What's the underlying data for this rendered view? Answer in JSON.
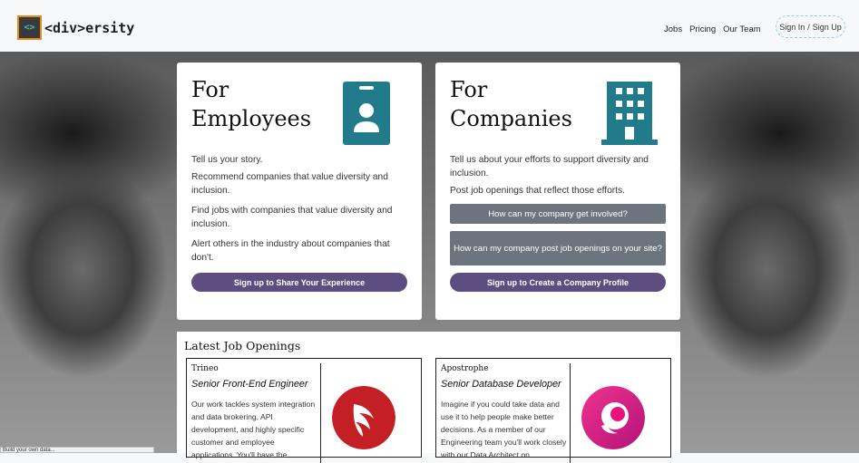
{
  "brand": {
    "name": "<div>ersity",
    "logo_glyph": "<>",
    "accent": "#e08a1a"
  },
  "nav": {
    "links": [
      "Jobs",
      "Pricing",
      "Our Team"
    ],
    "sign_in": "Sign In",
    "separator": "/",
    "sign_up": "Sign Up"
  },
  "employees": {
    "title_line1": "For",
    "title_line2": "Employees",
    "icon": "id-badge-icon",
    "texts": [
      "Tell us your story.",
      "Recommend companies that value diversity and inclusion.",
      "Find jobs with companies that value diversity and inclusion.",
      "Alert others in the industry about companies that don't."
    ],
    "cta": "Sign up to Share Your Experience"
  },
  "companies": {
    "title_line1": "For",
    "title_line2": "Companies",
    "icon": "building-icon",
    "texts": [
      "Tell us about your efforts to support diversity and inclusion.",
      "Post job openings that reflect those efforts."
    ],
    "faq1": "How can my company get involved?",
    "faq2": "How can my company post job openings on your site?",
    "cta": "Sign up to Create a Company Profile"
  },
  "jobs": {
    "title": "Latest Job Openings",
    "items": [
      {
        "company": "Trineo",
        "role": "Senior Front-End Engineer",
        "desc": "Our work tackles system integration and data brokering, API development, and highly specific customer and employee applications. You'll have the",
        "logo": "trineo-logo-icon",
        "logo_color": "#c41f24"
      },
      {
        "company": "Apostrophe",
        "role": "Senior Database Developer",
        "desc": "Imagine if you could take data and use it to help people make better decisions. As a member of our Engineering team you'll work closely with our Data Architect on",
        "logo": "apostrophe-logo-icon",
        "logo_color": "#e8127a"
      }
    ]
  },
  "status": "Build your own data..."
}
